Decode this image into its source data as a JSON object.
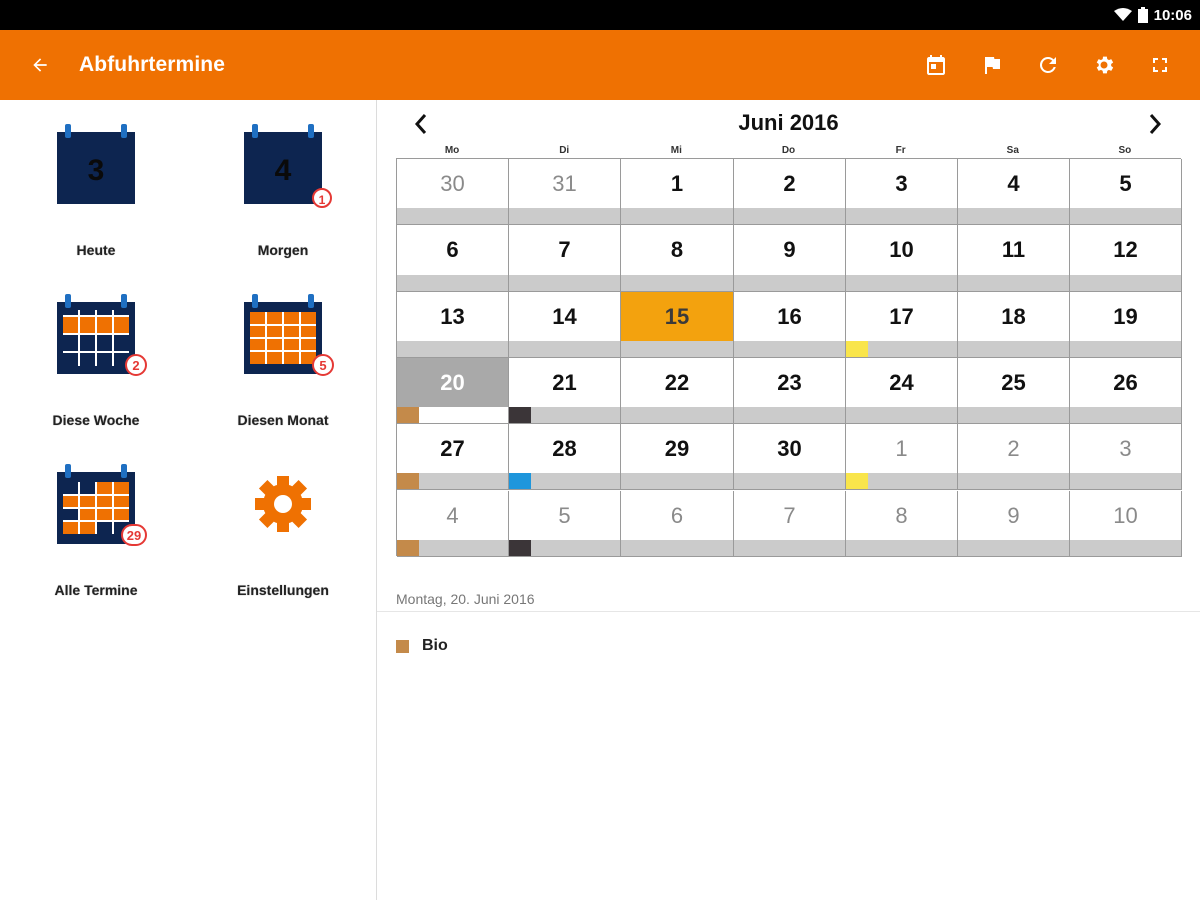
{
  "status_bar": {
    "time": "10:06"
  },
  "app_bar": {
    "title": "Abfuhrtermine",
    "actions": [
      "calendar-today-icon",
      "flag-icon",
      "refresh-icon",
      "settings-icon",
      "fullscreen-icon"
    ]
  },
  "tiles": [
    {
      "id": "today",
      "label": "Heute",
      "day": "3",
      "badge": ""
    },
    {
      "id": "tomorrow",
      "label": "Morgen",
      "day": "4",
      "badge": "1"
    },
    {
      "id": "week",
      "label": "Diese Woche",
      "day": "",
      "badge": "2"
    },
    {
      "id": "month",
      "label": "Diesen Monat",
      "day": "",
      "badge": "5"
    },
    {
      "id": "all",
      "label": "Alle Termine",
      "day": "",
      "badge": "29"
    },
    {
      "id": "settings",
      "label": "Einstellungen",
      "day": "",
      "badge": ""
    }
  ],
  "calendar": {
    "month_title": "Juni 2016",
    "weekdays": [
      "Mo",
      "Di",
      "Mi",
      "Do",
      "Fr",
      "Sa",
      "So"
    ],
    "weeks": [
      [
        {
          "d": "30",
          "m": true
        },
        {
          "d": "31",
          "m": true
        },
        {
          "d": "1"
        },
        {
          "d": "2"
        },
        {
          "d": "3"
        },
        {
          "d": "4"
        },
        {
          "d": "5"
        }
      ],
      [
        {
          "d": "6"
        },
        {
          "d": "7"
        },
        {
          "d": "8"
        },
        {
          "d": "9"
        },
        {
          "d": "10"
        },
        {
          "d": "11"
        },
        {
          "d": "12"
        }
      ],
      [
        {
          "d": "13"
        },
        {
          "d": "14"
        },
        {
          "d": "15",
          "today": true
        },
        {
          "d": "16"
        },
        {
          "d": "17",
          "mark": "#f9e54b"
        },
        {
          "d": "18"
        },
        {
          "d": "19"
        }
      ],
      [
        {
          "d": "20",
          "selected": true,
          "mark": "#c48a4a",
          "barWhite": true
        },
        {
          "d": "21",
          "mark": "#3b3538"
        },
        {
          "d": "22"
        },
        {
          "d": "23"
        },
        {
          "d": "24"
        },
        {
          "d": "25"
        },
        {
          "d": "26"
        }
      ],
      [
        {
          "d": "27",
          "mark": "#c48a4a"
        },
        {
          "d": "28",
          "mark": "#1e96dc"
        },
        {
          "d": "29"
        },
        {
          "d": "30"
        },
        {
          "d": "1",
          "m": true,
          "mark": "#f9e54b"
        },
        {
          "d": "2",
          "m": true
        },
        {
          "d": "3",
          "m": true
        }
      ],
      [
        {
          "d": "4",
          "m": true,
          "mark": "#c48a4a"
        },
        {
          "d": "5",
          "m": true,
          "mark": "#3b3538"
        },
        {
          "d": "6",
          "m": true
        },
        {
          "d": "7",
          "m": true
        },
        {
          "d": "8",
          "m": true
        },
        {
          "d": "9",
          "m": true
        },
        {
          "d": "10",
          "m": true
        }
      ]
    ]
  },
  "detail": {
    "date": "Montag, 20. Juni 2016",
    "items": [
      {
        "label": "Bio",
        "color": "#c48a4a"
      }
    ]
  },
  "colors": {
    "accent": "#ef7102",
    "icon_navy": "#0d2550",
    "icon_blue": "#1f6fc2",
    "icon_orange": "#ef7102",
    "badge_red": "#e53935",
    "today": "#f3a20e"
  }
}
